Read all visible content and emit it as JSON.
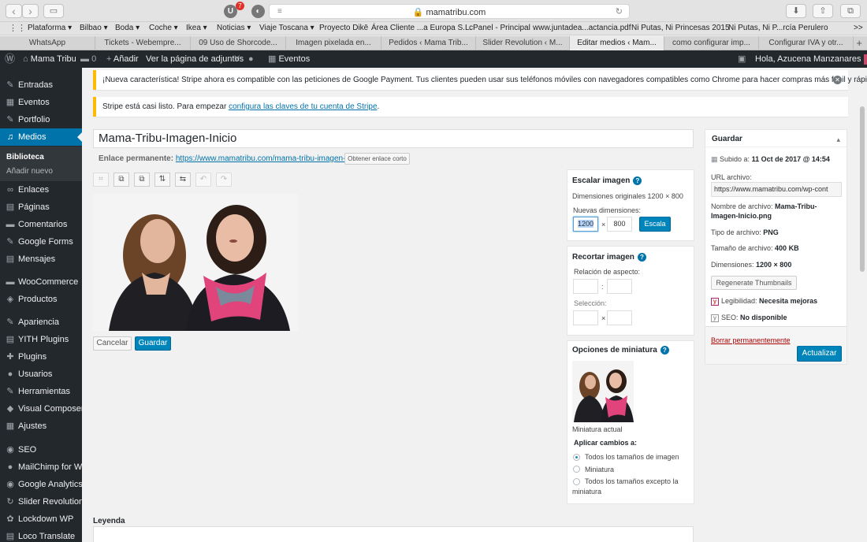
{
  "browser": {
    "url": "mamatribu.com",
    "extension_badge": "7",
    "bookmarks": [
      "Plataforma ▾",
      "Bilbao ▾",
      "Boda ▾",
      "Coche ▾",
      "Ikea ▾",
      "Noticias ▾",
      "Viaje Toscana ▾",
      "Proyecto Dikē",
      "Área Cliente ...a Europa S.L.",
      "cPanel - Principal",
      "www.juntadea...actancia.pdf",
      "Ni Putas, Ni Princesas 2015",
      "Ni Putas, Ni P...rcía Perulero",
      ">>"
    ],
    "tabs": [
      "WhatsApp",
      "Tickets - Webempre...",
      "09 Uso de Shorcode...",
      "Imagen pixelada en...",
      "Pedidos ‹ Mama Trib...",
      "Slider Revolution ‹ M...",
      "Editar medios ‹ Mam...",
      "como configurar imp...",
      "Configurar IVA y otr..."
    ]
  },
  "adminbar": {
    "site_name": "Mama Tribu",
    "comments_count": "0",
    "new_label": "Añadir",
    "view_label": "Ver la página de adjuntos",
    "events_label": "Eventos",
    "greeting": "Hola, Azucena Manzanares"
  },
  "menu": {
    "items": [
      {
        "label": "Entradas",
        "icon": "pin-icon",
        "glyph": "✎"
      },
      {
        "label": "Eventos",
        "icon": "calendar-icon",
        "glyph": "▦"
      },
      {
        "label": "Portfolio",
        "icon": "pin-icon",
        "glyph": "✎"
      },
      {
        "label": "Medios",
        "icon": "media-icon",
        "glyph": "♫"
      },
      {
        "label": "Enlaces",
        "icon": "link-icon",
        "glyph": "∞"
      },
      {
        "label": "Páginas",
        "icon": "page-icon",
        "glyph": "▤"
      },
      {
        "label": "Comentarios",
        "icon": "comment-icon",
        "glyph": "▬"
      },
      {
        "label": "Google Forms",
        "icon": "forms-icon",
        "glyph": "✎"
      },
      {
        "label": "Mensajes",
        "icon": "messages-icon",
        "glyph": "▤"
      },
      {
        "label": "WooCommerce",
        "icon": "woocommerce-icon",
        "glyph": "▬"
      },
      {
        "label": "Productos",
        "icon": "products-icon",
        "glyph": "◈"
      },
      {
        "label": "Apariencia",
        "icon": "brush-icon",
        "glyph": "✎"
      },
      {
        "label": "YITH Plugins",
        "icon": "yith-icon",
        "glyph": "▤"
      },
      {
        "label": "Plugins",
        "icon": "plugin-icon",
        "glyph": "✚"
      },
      {
        "label": "Usuarios",
        "icon": "users-icon",
        "glyph": "●"
      },
      {
        "label": "Herramientas",
        "icon": "wrench-icon",
        "glyph": "✎"
      },
      {
        "label": "Visual Composer",
        "icon": "visual-composer-icon",
        "glyph": "◆"
      },
      {
        "label": "Ajustes",
        "icon": "settings-icon",
        "glyph": "▦"
      },
      {
        "label": "SEO",
        "icon": "seo-icon",
        "glyph": "◉"
      },
      {
        "label": "MailChimp for WP",
        "icon": "mailchimp-icon",
        "glyph": "●"
      },
      {
        "label": "Google Analytics",
        "icon": "analytics-icon",
        "glyph": "◉"
      },
      {
        "label": "Slider Revolution",
        "icon": "slider-icon",
        "glyph": "↻"
      },
      {
        "label": "Lockdown WP",
        "icon": "lockdown-icon",
        "glyph": "✿"
      },
      {
        "label": "Loco Translate",
        "icon": "translate-icon",
        "glyph": "▤"
      }
    ],
    "submenu": [
      "Biblioteca",
      "Añadir nuevo"
    ]
  },
  "notices": {
    "payment": "¡Nueva característica! Stripe ahora es compatible con las peticiones de Google Payment. Tus clientes pueden usar sus teléfonos móviles con navegadores compatibles como Chrome para hacer compras más fácil y rápido.",
    "stripe_prefix": "Stripe está casi listo. Para empezar ",
    "stripe_link": "configura las claves de tu cuenta de Stripe",
    "stripe_suffix": "."
  },
  "editor": {
    "title": "Mama-Tribu-Imagen-Inicio",
    "permalink_label": "Enlace permanente:",
    "permalink_url": "https://www.mamatribu.com/mama-tribu-imagen-inicio/",
    "shortlink_button": "Obtener enlace corto",
    "cancel": "Cancelar",
    "save": "Guardar",
    "legend_label": "Leyenda"
  },
  "scale": {
    "title": "Escalar imagen",
    "original_dims": "Dimensiones originales 1200 × 800",
    "new_dims_label": "Nuevas dimensiones:",
    "width": "1200",
    "height": "800",
    "times": "×",
    "button": "Escala"
  },
  "crop": {
    "title": "Recortar imagen",
    "ratio_label": "Relación de aspecto:",
    "ratio_sep": ":",
    "selection_label": "Selección:",
    "times": "×"
  },
  "thumbnail": {
    "title": "Opciones de miniatura",
    "caption": "Miniatura actual",
    "apply_label": "Aplicar cambios a:",
    "options": [
      "Todos los tamaños de imagen",
      "Miniatura",
      "Todos los tamaños excepto la",
      "miniatura"
    ]
  },
  "savebox": {
    "title": "Guardar",
    "uploaded_label": "Subido a: ",
    "uploaded_value": "11 Oct de 2017 @ 14:54",
    "url_label": "URL archivo:",
    "url_value": "https://www.mamatribu.com/wp-cont",
    "filename_label": "Nombre de archivo: ",
    "filename_value_1": "Mama-Tribu-",
    "filename_value_2": "Imagen-Inicio.png",
    "filetype_label": "Tipo de archivo: ",
    "filetype_value": "PNG",
    "filesize_label": "Tamaño de archivo: ",
    "filesize_value": "400 KB",
    "dims_label": "Dimensiones: ",
    "dims_value": "1200 × 800",
    "regenerate": "Regenerate Thumbnails",
    "readability_label": "Legibilidad: ",
    "readability_value": "Necesita mejoras",
    "seo_label": "SEO: ",
    "seo_value": "No disponible",
    "delete": "Borrar permanentemente",
    "update": "Actualizar"
  },
  "colors": {
    "wp_dark": "#23282d",
    "wp_blue": "#0073aa",
    "button_primary": "#0085ba",
    "notice_warning": "#ffb900"
  }
}
